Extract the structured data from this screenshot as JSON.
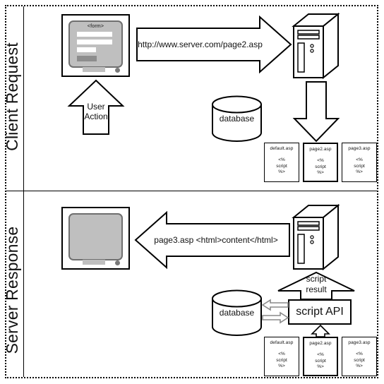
{
  "diagram": {
    "title": "ASP client request / server response flow",
    "sections": [
      {
        "id": "client",
        "label": "Client Request"
      },
      {
        "id": "server",
        "label": "Server Response"
      }
    ]
  },
  "client": {
    "browser": {
      "form_label": "<form>",
      "fields": 3,
      "button": "submit-button"
    },
    "user_action_arrow": {
      "line1": "User",
      "line2": "Action",
      "direction": "up"
    },
    "request_arrow": {
      "label": "http://www.server.com/page2.asp",
      "direction": "right"
    },
    "server_icon": "server-tower-icon",
    "download_arrow": {
      "direction": "down"
    },
    "database": {
      "label": "database"
    },
    "files": [
      {
        "name": "default.asp",
        "body": "<%\nscript\n%>",
        "highlight": false
      },
      {
        "name": "page2.asp",
        "body": "<%\nscript\n%>",
        "highlight": true
      },
      {
        "name": "page3.asp",
        "body": "<%\nscript\n%>",
        "highlight": false
      }
    ]
  },
  "server": {
    "browser": {
      "screen": "rendered-page"
    },
    "response_arrow": {
      "label": "page3.asp <html>content</html>",
      "direction": "left"
    },
    "server_icon": "server-tower-icon",
    "script_result_arrow": {
      "line1": "script",
      "line2": "result",
      "direction": "up"
    },
    "api_box": {
      "label": "script API"
    },
    "database": {
      "label": "database"
    },
    "db_arrows": [
      {
        "direction": "left",
        "name": "db-read-arrow"
      },
      {
        "direction": "right",
        "name": "db-write-arrow"
      }
    ],
    "files_arrow": {
      "direction": "up"
    },
    "files": [
      {
        "name": "default.asp",
        "body": "<%\nscript\n%>",
        "highlight": false
      },
      {
        "name": "page2.asp",
        "body": "<%\nscript\n%>",
        "highlight": true
      },
      {
        "name": "page3.asp",
        "body": "<%\nscript\n%>",
        "highlight": false
      }
    ]
  },
  "colors": {
    "stroke": "#000000",
    "screen_fill": "#bfbfbf",
    "screen_border": "#6f6f6f",
    "button_fill": "#8d8d8d",
    "gray_arrow_stroke": "#8a8a8a",
    "paper": "#ffffff"
  }
}
